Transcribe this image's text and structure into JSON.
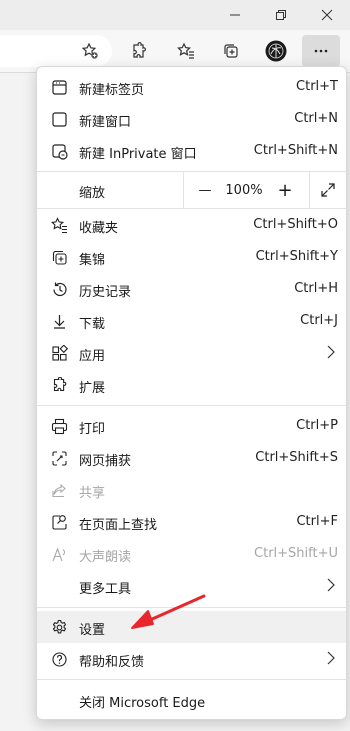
{
  "window": {
    "minimize_icon": "minimize-icon",
    "maximize_icon": "restore-icon",
    "close_icon": "close-icon"
  },
  "toolbar": {
    "icons": [
      "add-favorite-icon",
      "extensions-icon",
      "favorites-icon",
      "collections-icon",
      "profile-avatar",
      "more-icon"
    ]
  },
  "menu": {
    "new_tab": {
      "label": "新建标签页",
      "shortcut": "Ctrl+T"
    },
    "new_window": {
      "label": "新建窗口",
      "shortcut": "Ctrl+N"
    },
    "new_inprivate": {
      "label": "新建 InPrivate 窗口",
      "shortcut": "Ctrl+Shift+N"
    },
    "zoom": {
      "label": "缩放",
      "value": "100%",
      "minus": "—",
      "plus": "+"
    },
    "favorites": {
      "label": "收藏夹",
      "shortcut": "Ctrl+Shift+O"
    },
    "collections": {
      "label": "集锦",
      "shortcut": "Ctrl+Shift+Y"
    },
    "history": {
      "label": "历史记录",
      "shortcut": "Ctrl+H"
    },
    "downloads": {
      "label": "下载",
      "shortcut": "Ctrl+J"
    },
    "apps": {
      "label": "应用"
    },
    "extensions": {
      "label": "扩展"
    },
    "print": {
      "label": "打印",
      "shortcut": "Ctrl+P"
    },
    "web_capture": {
      "label": "网页捕获",
      "shortcut": "Ctrl+Shift+S"
    },
    "share": {
      "label": "共享"
    },
    "find": {
      "label": "在页面上查找",
      "shortcut": "Ctrl+F"
    },
    "read_aloud": {
      "label": "大声朗读",
      "shortcut": "Ctrl+Shift+U"
    },
    "more_tools": {
      "label": "更多工具"
    },
    "settings": {
      "label": "设置"
    },
    "help": {
      "label": "帮助和反馈"
    },
    "close_edge": {
      "label": "关闭 Microsoft Edge"
    }
  },
  "colors": {
    "annotation_arrow": "#e8262b",
    "highlight": "#f0f0f0"
  }
}
